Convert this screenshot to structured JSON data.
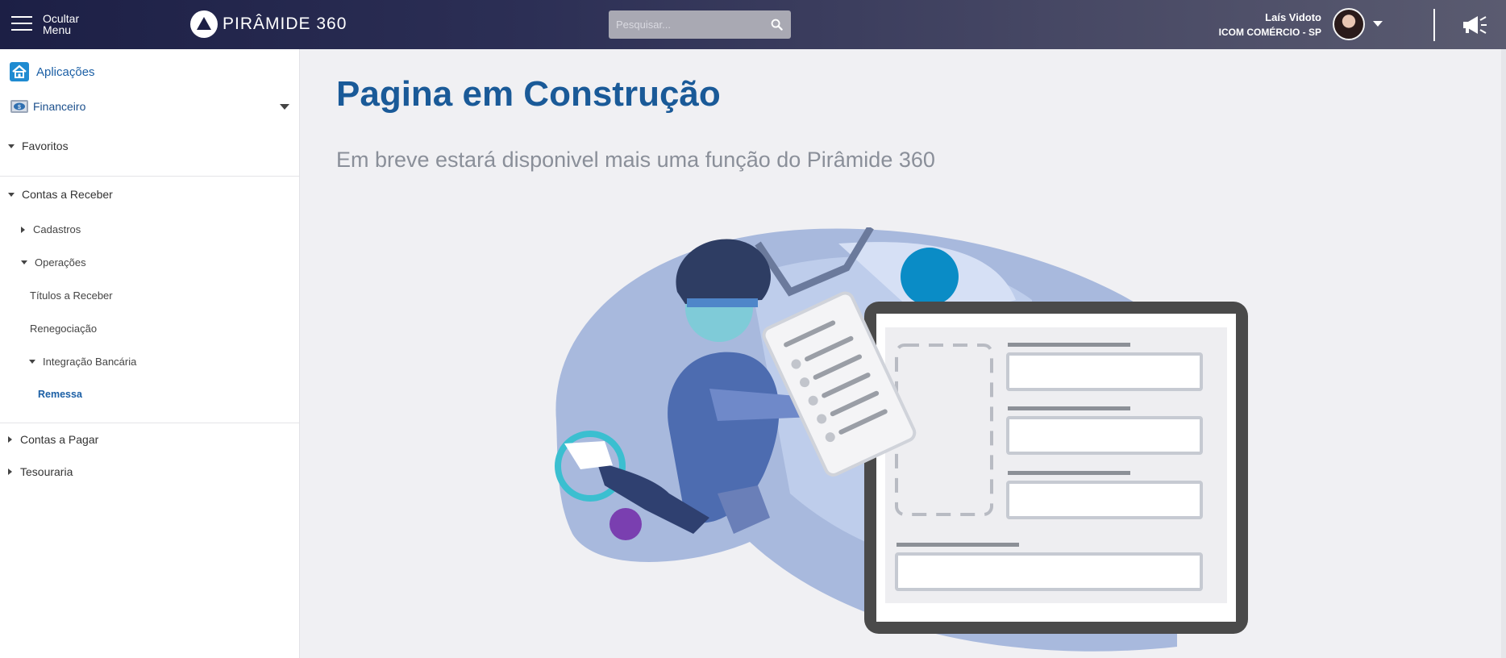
{
  "header": {
    "menu_toggle_line1": "Ocultar",
    "menu_toggle_line2": "Menu",
    "logo_text": "PIRÂMIDE 360",
    "search_placeholder": "Pesquisar...",
    "user_name": "Laís Vidoto",
    "user_company": "ICOM COMÉRCIO - SP"
  },
  "sidebar": {
    "applications_label": "Aplicações",
    "module_label": "Financeiro",
    "items": [
      {
        "label": "Favoritos",
        "level": 0,
        "expanded": true
      },
      {
        "label": "Contas a Receber",
        "level": 0,
        "expanded": true
      },
      {
        "label": "Cadastros",
        "level": 1,
        "expanded": false
      },
      {
        "label": "Operações",
        "level": 1,
        "expanded": true
      },
      {
        "label": "Títulos a Receber",
        "level": 2
      },
      {
        "label": "Renegociação",
        "level": 2
      },
      {
        "label": "Integração Bancária",
        "level": 2,
        "expanded": true
      },
      {
        "label": "Remessa",
        "level": 3,
        "active": true
      },
      {
        "label": "Contas a Pagar",
        "level": 0,
        "expanded": false
      },
      {
        "label": "Tesouraria",
        "level": 0,
        "expanded": false
      }
    ]
  },
  "main": {
    "title": "Pagina em Construção",
    "subtitle": "Em breve estará disponivel mais uma função do Pirâmide 360"
  },
  "colors": {
    "accent": "#1a5a98",
    "topbar_start": "#1c1f45",
    "active_link": "#1b5fa5"
  }
}
